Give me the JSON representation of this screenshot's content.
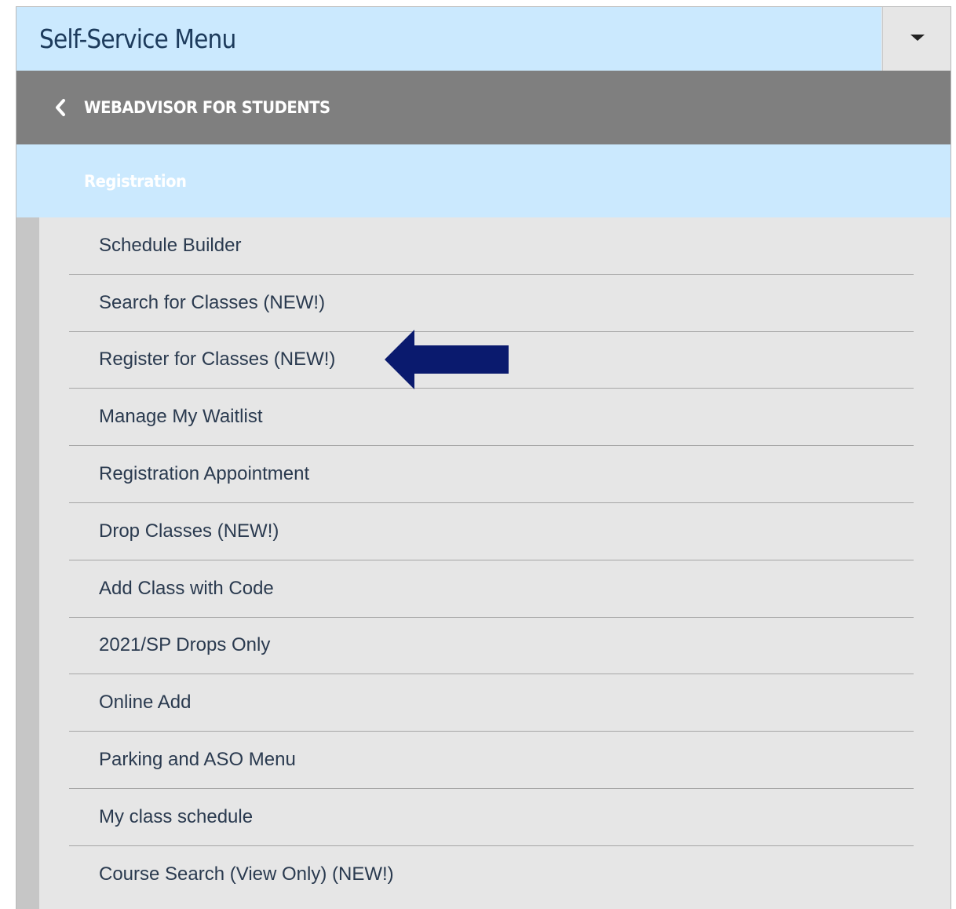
{
  "header": {
    "title": "Self-Service Menu",
    "toggle_icon": "caret-down-icon"
  },
  "back_bar": {
    "label": "WEBADVISOR FOR STUDENTS",
    "icon": "chevron-left-icon"
  },
  "section": {
    "label": "Registration"
  },
  "menu": {
    "items": [
      {
        "label": "Schedule Builder"
      },
      {
        "label": "Search for Classes (NEW!)"
      },
      {
        "label": "Register for Classes (NEW!)"
      },
      {
        "label": "Manage My Waitlist"
      },
      {
        "label": "Registration Appointment"
      },
      {
        "label": "Drop Classes (NEW!)"
      },
      {
        "label": "Add Class with Code"
      },
      {
        "label": "2021/SP Drops Only"
      },
      {
        "label": "Online Add"
      },
      {
        "label": "Parking and ASO Menu"
      },
      {
        "label": "My class schedule"
      },
      {
        "label": "Course Search (View Only) (NEW!)"
      }
    ]
  },
  "annotation": {
    "icon": "left-arrow-pointer-icon",
    "color": "#0a1a6e"
  },
  "colors": {
    "header_bg": "#cbe9fe",
    "back_bar_bg": "#7f7f7f",
    "menu_bg": "#e6e6e6",
    "accent_strip": "#c6c6c6"
  }
}
